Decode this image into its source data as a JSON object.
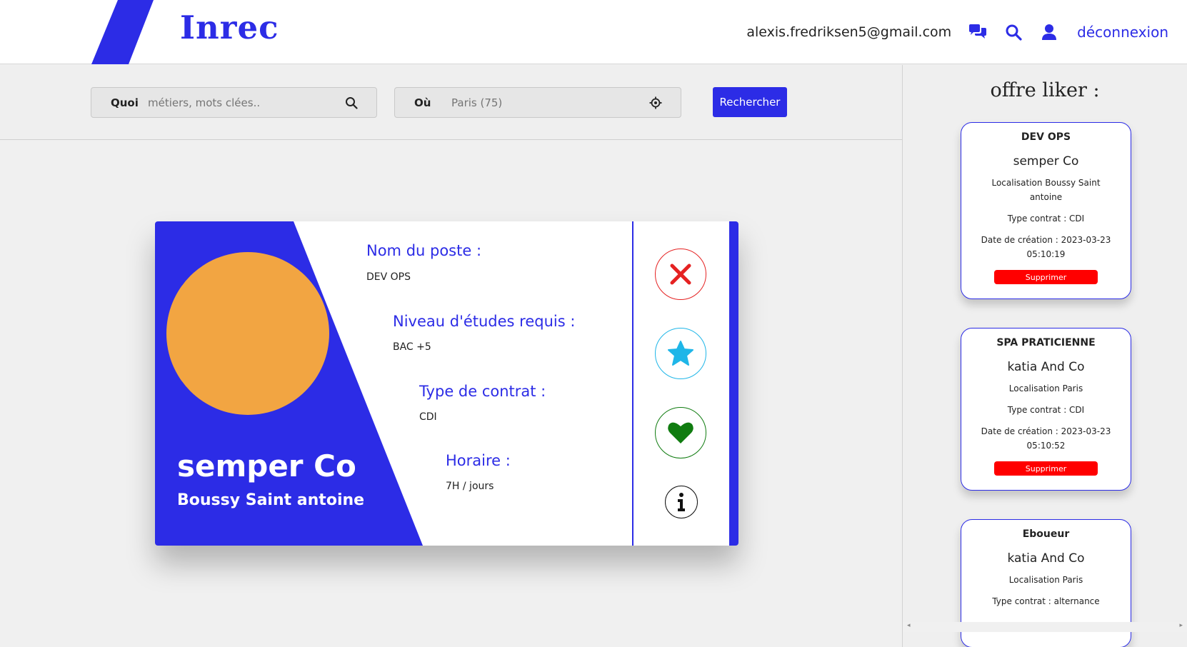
{
  "header": {
    "logo": "Inrec",
    "email": "alexis.fredriksen5@gmail.com",
    "logout_label": "déconnexion",
    "accent": "#2c2ce6"
  },
  "search": {
    "what_label": "Quoi",
    "what_placeholder": "métiers, mots clées..",
    "where_label": "Où",
    "where_placeholder": "Paris (75)",
    "button_label": "Rechercher"
  },
  "card": {
    "company": "semper Co",
    "city": "Boussy Saint antoine",
    "avatar_color": "#f2a542",
    "fields": [
      {
        "label": "Nom du poste :",
        "value": "DEV OPS"
      },
      {
        "label": "Niveau d'études requis :",
        "value": "BAC +5"
      },
      {
        "label": "Type de contrat :",
        "value": "CDI"
      },
      {
        "label": "Horaire :",
        "value": "7H / jours"
      }
    ],
    "actions": [
      "close-icon",
      "star-icon",
      "heart-icon",
      "info-icon"
    ]
  },
  "sidebar": {
    "title": "offre liker :",
    "offers": [
      {
        "title": "DEV OPS",
        "company": "semper Co",
        "location": "Localisation Boussy Saint antoine",
        "contract": "Type contrat : CDI",
        "created": "Date de création : 2023-03-23 05:10:19",
        "delete_label": "Supprimer"
      },
      {
        "title": "SPA PRATICIENNE",
        "company": "katia And Co",
        "location": "Localisation Paris",
        "contract": "Type contrat : CDI",
        "created": "Date de création : 2023-03-23 05:10:52",
        "delete_label": "Supprimer"
      },
      {
        "title": "Eboueur",
        "company": "katia And Co",
        "location": "Localisation Paris",
        "contract": "Type contrat : alternance"
      }
    ]
  }
}
